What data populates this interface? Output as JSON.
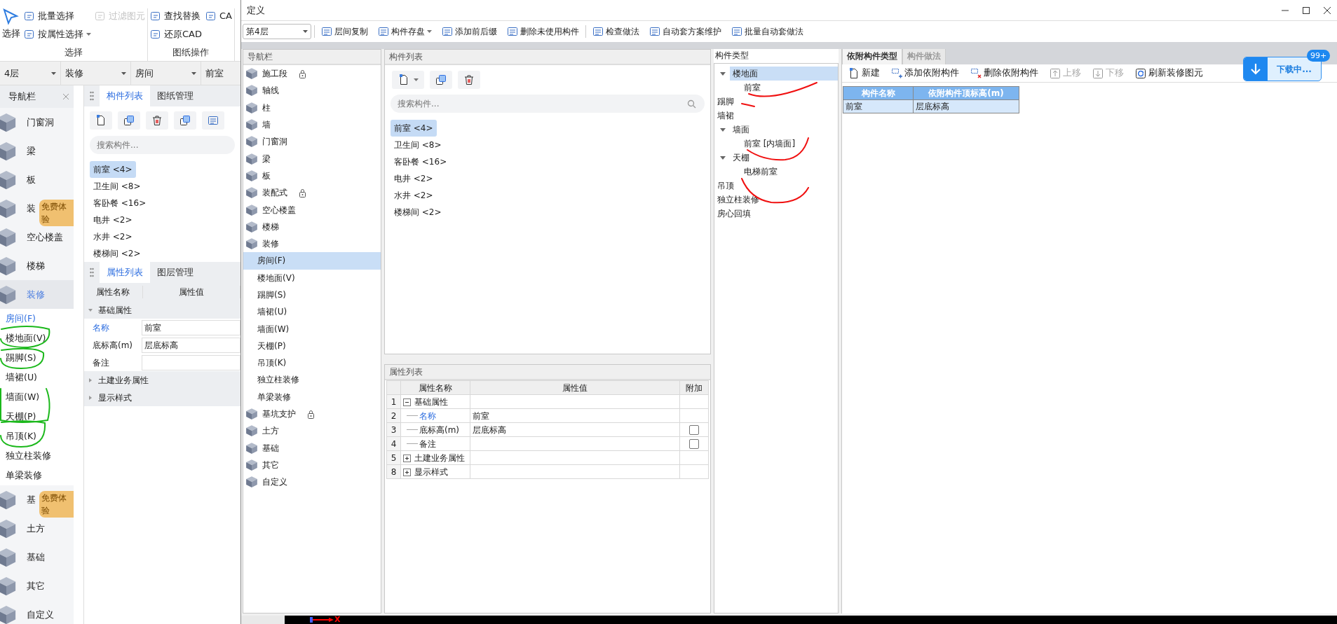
{
  "background_app": {
    "ribbon_groups": [
      {
        "label": "选择",
        "columns": [
          [
            {
              "label": "选择",
              "kind": "large"
            }
          ],
          [
            {
              "label": "批量选择",
              "kind": "small",
              "disabled": false
            },
            {
              "label": "按属性选择",
              "kind": "dropdown",
              "disabled": false
            }
          ],
          [
            {
              "label": "过滤图元",
              "kind": "small",
              "disabled": true
            }
          ]
        ]
      },
      {
        "label": "图纸操作",
        "columns": [
          [
            {
              "label": "查找替换",
              "kind": "small",
              "disabled": false
            },
            {
              "label": "还原CAD",
              "kind": "small",
              "disabled": false
            }
          ],
          [
            {
              "label": "CA",
              "kind": "small",
              "disabled": false
            }
          ]
        ]
      }
    ],
    "selectors": [
      {
        "value": "4层",
        "dropdown": true
      },
      {
        "value": "装修",
        "dropdown": true
      },
      {
        "value": "房间",
        "dropdown": true
      },
      {
        "value": "前室",
        "dropdown": false
      }
    ],
    "nav": {
      "title": "导航栏",
      "items": [
        {
          "label": "门窗洞",
          "selected": false
        },
        {
          "label": "梁",
          "selected": false
        },
        {
          "label": "板",
          "selected": false
        },
        {
          "label": "装",
          "selected": false,
          "badge": "免费体验"
        },
        {
          "label": "空心楼盖",
          "selected": false
        },
        {
          "label": "楼梯",
          "selected": false
        },
        {
          "label": "装修",
          "selected": true,
          "children": [
            {
              "label": "房间(F)",
              "selected": true
            },
            {
              "label": "楼地面(V)",
              "selected": false
            },
            {
              "label": "踢脚(S)",
              "selected": false
            },
            {
              "label": "墙裙(U)",
              "selected": false
            },
            {
              "label": "墙面(W)",
              "selected": false
            },
            {
              "label": "天棚(P)",
              "selected": false
            },
            {
              "label": "吊顶(K)",
              "selected": false
            },
            {
              "label": "独立柱装修",
              "selected": false
            },
            {
              "label": "单梁装修",
              "selected": false
            }
          ]
        },
        {
          "label": "基",
          "selected": false,
          "badge": "免费体验"
        },
        {
          "label": "土方",
          "selected": false
        },
        {
          "label": "基础",
          "selected": false
        },
        {
          "label": "其它",
          "selected": false
        },
        {
          "label": "自定义",
          "selected": false
        }
      ]
    },
    "component_tabs": [
      {
        "label": "构件列表",
        "selected": true
      },
      {
        "label": "图纸管理",
        "selected": false
      }
    ],
    "search": {
      "placeholder": "搜索构件..."
    },
    "components": [
      {
        "label": "前室 <4>",
        "selected": true
      },
      {
        "label": "卫生间 <8>",
        "selected": false
      },
      {
        "label": "客卧餐 <16>",
        "selected": false
      },
      {
        "label": "电井 <2>",
        "selected": false
      },
      {
        "label": "水井 <2>",
        "selected": false
      },
      {
        "label": "楼梯间 <2>",
        "selected": false
      }
    ],
    "property_tabs": [
      {
        "label": "属性列表",
        "selected": true
      },
      {
        "label": "图层管理",
        "selected": false
      }
    ],
    "property_columns": [
      "属性名称",
      "属性值"
    ],
    "property_rows": [
      {
        "kind": "group",
        "label": "基础属性",
        "expanded": true
      },
      {
        "kind": "field",
        "label": "名称",
        "value": "前室",
        "highlight": true
      },
      {
        "kind": "field",
        "label": "底标高(m)",
        "value": "层底标高",
        "highlight": false
      },
      {
        "kind": "field",
        "label": "备注",
        "highlight": false
      },
      {
        "kind": "group",
        "label": "土建业务属性",
        "expanded": false
      },
      {
        "kind": "group",
        "label": "显示样式",
        "expanded": false
      }
    ],
    "axis_label": "X"
  },
  "dialog": {
    "title": "定义",
    "floor_select": "第4层",
    "toolbar_groups": [
      [
        {
          "label": "层间复制",
          "dropdown": false
        },
        {
          "label": "构件存盘",
          "dropdown": true
        },
        {
          "label": "添加前后缀",
          "dropdown": false
        },
        {
          "label": "删除未使用构件",
          "dropdown": false
        }
      ],
      [
        {
          "label": "检查做法",
          "dropdown": false
        },
        {
          "label": "自动套方案维护",
          "dropdown": false
        },
        {
          "label": "批量自动套做法",
          "dropdown": false
        }
      ]
    ],
    "nav": {
      "title": "导航栏",
      "items": [
        {
          "label": "施工段",
          "locked": true,
          "selected": false
        },
        {
          "label": "轴线",
          "locked": false,
          "selected": false
        },
        {
          "label": "柱",
          "locked": false,
          "selected": false
        },
        {
          "label": "墙",
          "locked": false,
          "selected": false
        },
        {
          "label": "门窗洞",
          "locked": false,
          "selected": false
        },
        {
          "label": "梁",
          "locked": false,
          "selected": false
        },
        {
          "label": "板",
          "locked": false,
          "selected": false
        },
        {
          "label": "装配式",
          "locked": true,
          "selected": false
        },
        {
          "label": "空心楼盖",
          "locked": false,
          "selected": false
        },
        {
          "label": "楼梯",
          "locked": false,
          "selected": false
        },
        {
          "label": "装修",
          "locked": false,
          "selected": false,
          "children": [
            {
              "label": "房间(F)",
              "selected": true
            },
            {
              "label": "楼地面(V)",
              "selected": false
            },
            {
              "label": "踢脚(S)",
              "selected": false
            },
            {
              "label": "墙裙(U)",
              "selected": false
            },
            {
              "label": "墙面(W)",
              "selected": false
            },
            {
              "label": "天棚(P)",
              "selected": false
            },
            {
              "label": "吊顶(K)",
              "selected": false
            },
            {
              "label": "独立柱装修",
              "selected": false
            },
            {
              "label": "单梁装修",
              "selected": false
            }
          ]
        },
        {
          "label": "基坑支护",
          "locked": true,
          "selected": false
        },
        {
          "label": "土方",
          "locked": false,
          "selected": false
        },
        {
          "label": "基础",
          "locked": false,
          "selected": false
        },
        {
          "label": "其它",
          "locked": false,
          "selected": false
        },
        {
          "label": "自定义",
          "locked": false,
          "selected": false
        }
      ]
    },
    "component_list": {
      "title": "构件列表",
      "search": {
        "placeholder": "搜索构件..."
      },
      "items": [
        {
          "label": "前室 <4>",
          "selected": true
        },
        {
          "label": "卫生间 <8>",
          "selected": false
        },
        {
          "label": "客卧餐 <16>",
          "selected": false
        },
        {
          "label": "电井 <2>",
          "selected": false
        },
        {
          "label": "水井 <2>",
          "selected": false
        },
        {
          "label": "楼梯间 <2>",
          "selected": false
        }
      ]
    },
    "property_list": {
      "title": "属性列表",
      "columns": [
        "属性名称",
        "属性值",
        "附加"
      ],
      "rows": [
        {
          "index": "1",
          "kind": "group",
          "label": "基础属性",
          "expanded": true
        },
        {
          "index": "2",
          "kind": "field",
          "label": "名称",
          "value": "前室",
          "highlight": true
        },
        {
          "index": "3",
          "kind": "field",
          "label": "底标高(m)",
          "value": "层底标高",
          "highlight": false,
          "checked": false
        },
        {
          "index": "4",
          "kind": "field",
          "label": "备注",
          "highlight": false,
          "checked": false
        },
        {
          "index": "5",
          "kind": "group",
          "label": "土建业务属性",
          "expanded": false
        },
        {
          "index": "8",
          "kind": "group",
          "label": "显示样式",
          "expanded": false
        }
      ]
    },
    "type_tree": {
      "title": "构件类型",
      "items": [
        {
          "label": "楼地面",
          "expanded": true,
          "selected": true,
          "children": [
            {
              "label": "前室",
              "selected": false
            }
          ]
        },
        {
          "label": "踢脚",
          "selected": false
        },
        {
          "label": "墙裙",
          "selected": false
        },
        {
          "label": "墙面",
          "expanded": true,
          "selected": false,
          "children": [
            {
              "label": "前室 [内墙面]",
              "selected": false
            }
          ]
        },
        {
          "label": "天棚",
          "expanded": true,
          "selected": false,
          "children": [
            {
              "label": "电梯前室",
              "selected": false
            }
          ]
        },
        {
          "label": "吊顶",
          "selected": false
        },
        {
          "label": "独立柱装修",
          "selected": false
        },
        {
          "label": "房心回填",
          "selected": false
        }
      ]
    },
    "detail_tabs": [
      {
        "label": "依附构件类型",
        "selected": true
      },
      {
        "label": "构件做法",
        "selected": false
      }
    ],
    "detail_toolbar": [
      {
        "label": "新建",
        "kind": "new",
        "disabled": false
      },
      {
        "label": "添加依附构件",
        "kind": "add",
        "disabled": false
      },
      {
        "label": "删除依附构件",
        "kind": "delete",
        "disabled": false
      },
      {
        "label": "上移",
        "kind": "up",
        "disabled": true
      },
      {
        "label": "下移",
        "kind": "down",
        "disabled": true
      },
      {
        "label": "刷新装修图元",
        "kind": "refresh",
        "disabled": false
      }
    ],
    "attached_table": {
      "columns": [
        "构件名称",
        "依附构件顶标高(m)"
      ],
      "rows": [
        [
          "前室",
          "层底标高"
        ]
      ]
    }
  },
  "download_badge": {
    "label": "下载中...",
    "count": "99+"
  }
}
